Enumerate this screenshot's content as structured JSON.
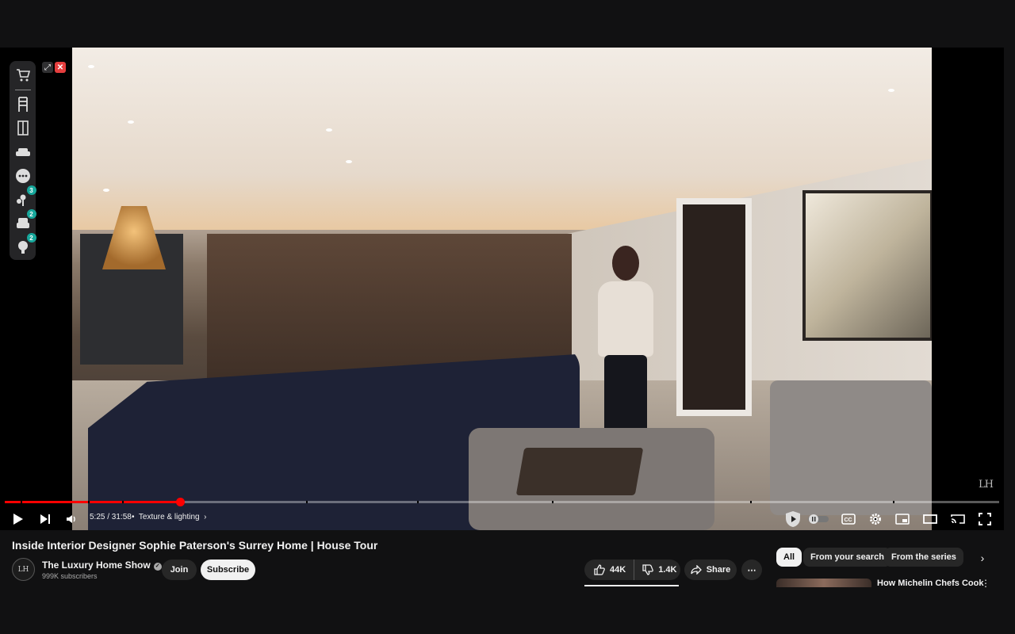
{
  "extension": {
    "items": [
      {
        "icon": "cart-icon",
        "badge": ""
      },
      {
        "icon": "chair-icon",
        "badge": ""
      },
      {
        "icon": "wardrobe-icon",
        "badge": ""
      },
      {
        "icon": "sofa-icon",
        "badge": ""
      },
      {
        "icon": "more-dots-icon",
        "badge": ""
      },
      {
        "icon": "plant-icon",
        "badge": "3"
      },
      {
        "icon": "armchair-icon",
        "badge": "2"
      },
      {
        "icon": "lamp-icon",
        "badge": "2"
      }
    ]
  },
  "player": {
    "current_time": "5:25",
    "duration": "31:58",
    "time_display": "5:25 / 31:58",
    "progress_fraction": 0.176,
    "chapter": "Texture & lighting",
    "chapter_separator": "•",
    "watermark": "LH",
    "accent_color": "#ff0000"
  },
  "video": {
    "title": "Inside Interior Designer Sophie Paterson's Surrey Home | House Tour"
  },
  "channel": {
    "avatar_text": "LH",
    "name": "The Luxury Home Show",
    "subscribers": "999K subscribers",
    "join_label": "Join",
    "subscribe_label": "Subscribe"
  },
  "actions": {
    "likes": "44K",
    "dislikes": "1.4K",
    "share_label": "Share",
    "more": "⋯"
  },
  "chips": {
    "items": [
      {
        "label": "All",
        "active": true
      },
      {
        "label": "From your search",
        "active": false
      },
      {
        "label": "From the series",
        "active": false
      }
    ]
  },
  "recommendation": {
    "title": "How Michelin Chefs Cook"
  }
}
